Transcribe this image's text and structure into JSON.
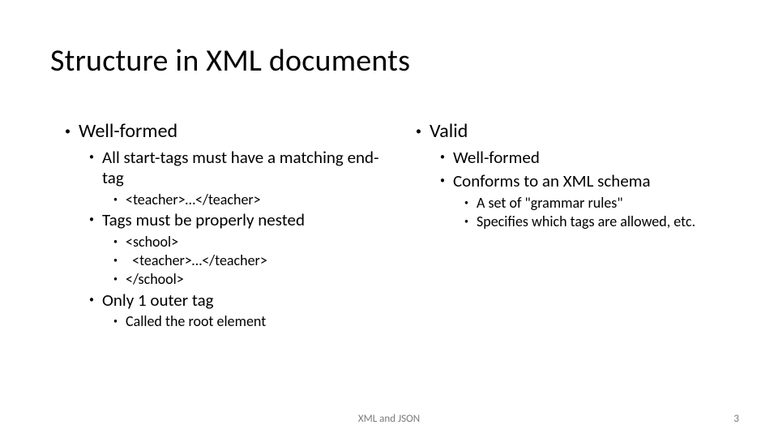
{
  "title": "Structure in XML documents",
  "left": {
    "heading": "Well-formed",
    "p1": "All start-tags must have a matching end-tag",
    "p1a": "<teacher>…</teacher>",
    "p2": "Tags must be properly nested",
    "p2a": "<school>",
    "p2b": "  <teacher>…</teacher>",
    "p2c": "</school>",
    "p3": "Only 1 outer tag",
    "p3a": "Called the root element"
  },
  "right": {
    "heading": "Valid",
    "p1": "Well-formed",
    "p2": "Conforms to an XML schema",
    "p2a": "A set of \"grammar rules\"",
    "p2b": "Specifies which tags are allowed, etc."
  },
  "footer": {
    "center": "XML and JSON",
    "page": "3"
  }
}
